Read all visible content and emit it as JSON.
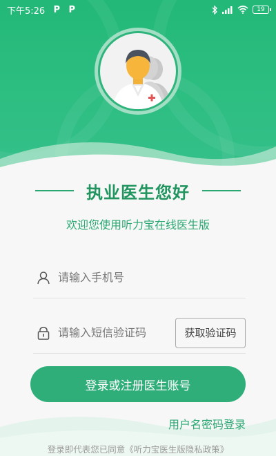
{
  "statusbar": {
    "time": "下午5:26",
    "notif_icon_1": "P",
    "notif_icon_2": "P",
    "battery": "19",
    "icons": [
      "bluetooth-icon",
      "signal-icon",
      "wifi-icon",
      "battery-icon"
    ]
  },
  "header": {
    "avatar_icon": "doctor-avatar-icon"
  },
  "title": "执业医生您好",
  "subtitle": "欢迎您使用听力宝在线医生版",
  "phone_field": {
    "placeholder": "请输入手机号",
    "value": "",
    "icon": "user-icon"
  },
  "code_field": {
    "placeholder": "请输入短信验证码",
    "value": "",
    "icon": "lock-icon",
    "button_label": "获取验证码"
  },
  "login_button": "登录或注册医生账号",
  "password_login_link": "用户名密码登录",
  "agreement_text": "登录即代表您已同意《听力宝医生版隐私政策》",
  "colors": {
    "brand_green": "#2fae79",
    "header_green": "#23b877",
    "title_green": "#21955f"
  }
}
